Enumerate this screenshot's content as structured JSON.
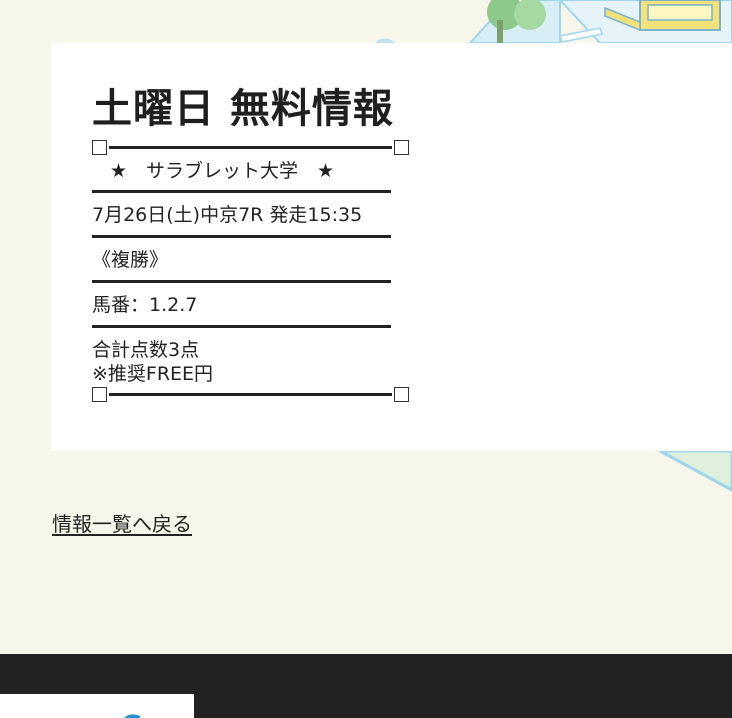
{
  "page": {
    "title": "土曜日 無料情報",
    "subtitle": "★　サラブレット大学　★",
    "race_info": "7月26日(土)中京7R 発走15:35",
    "bet_type": "《複勝》",
    "horse_numbers": "馬番：1.2.7",
    "total_points": "合計点数3点",
    "recommended": "※推奨FREE円"
  },
  "nav": {
    "back_link_label": "情報一覧へ戻る"
  },
  "colors": {
    "background": "#f7f6ea",
    "card": "#ffffff",
    "footer": "#222222",
    "text": "#222222",
    "illustration_blue": "#9fd6ee",
    "illustration_yellow": "#f5e17a",
    "illustration_green": "#8cc98a"
  }
}
